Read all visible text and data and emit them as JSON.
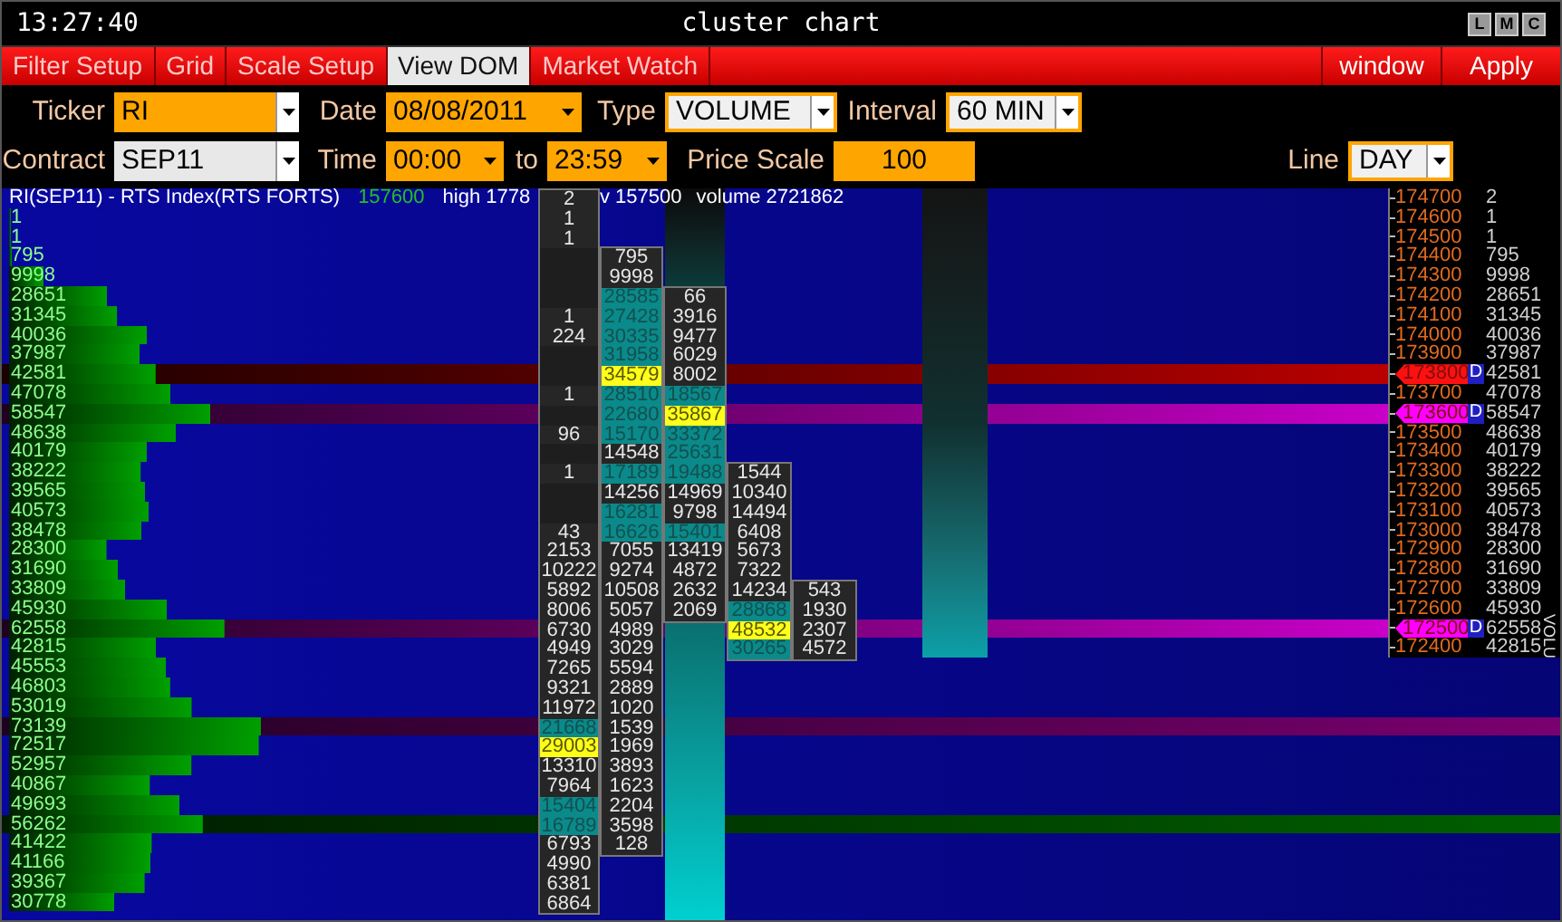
{
  "window": {
    "clock": "13:27:40",
    "title": "cluster chart",
    "buttons": [
      "L",
      "M",
      "C"
    ]
  },
  "menu": {
    "tabs": [
      {
        "label": "Filter Setup",
        "selected": false
      },
      {
        "label": "Grid",
        "selected": false
      },
      {
        "label": "Scale Setup",
        "selected": false
      },
      {
        "label": "View DOM",
        "selected": true
      },
      {
        "label": "Market Watch",
        "selected": false
      }
    ],
    "actions": [
      "window",
      "Apply"
    ]
  },
  "form": {
    "rows": [
      [
        {
          "label": "Ticker",
          "value": "RI",
          "kind": "orange-box"
        },
        {
          "label": "Date",
          "value": "08/08/2011",
          "kind": "orange-inline"
        },
        {
          "label": "Type",
          "value": "VOLUME",
          "kind": "outlined-box"
        },
        {
          "label": "Interval",
          "value": "60 MIN",
          "kind": "outlined-box"
        }
      ],
      [
        {
          "label": "Contract",
          "value": "SEP11",
          "kind": "light-box"
        },
        {
          "label": "Time",
          "value": "00:00",
          "kind": "orange-inline"
        },
        {
          "label": "to",
          "value": "23:59",
          "kind": "orange-inline"
        },
        {
          "label": "Price Scale",
          "value": "100",
          "kind": "orange-plain"
        },
        {
          "label": "Line",
          "value": "DAY",
          "kind": "outlined-box"
        }
      ]
    ]
  },
  "chart": {
    "header": {
      "symbol": "RI(SEP11) - RTS Index(RTS FORTS)",
      "last": "157600",
      "high": "high 1778",
      "low": "v 157500",
      "volume": "volume 2721862"
    },
    "profile": [
      {
        "value": "1"
      },
      {
        "value": "1"
      },
      {
        "value": "795"
      },
      {
        "value": "9998"
      },
      {
        "value": "28651"
      },
      {
        "value": "31345"
      },
      {
        "value": "40036"
      },
      {
        "value": "37987"
      },
      {
        "value": "42581",
        "kind": "red"
      },
      {
        "value": "47078"
      },
      {
        "value": "58547",
        "kind": "magenta"
      },
      {
        "value": "48638"
      },
      {
        "value": "40179"
      },
      {
        "value": "38222"
      },
      {
        "value": "39565"
      },
      {
        "value": "40573"
      },
      {
        "value": "38478"
      },
      {
        "value": "28300"
      },
      {
        "value": "31690"
      },
      {
        "value": "33809"
      },
      {
        "value": "45930"
      },
      {
        "value": "62558",
        "kind": "magenta"
      },
      {
        "value": "42815"
      },
      {
        "value": "45553"
      },
      {
        "value": "46803"
      },
      {
        "value": "53019"
      },
      {
        "value": "73139",
        "kind": "purple"
      },
      {
        "value": "72517"
      },
      {
        "value": "52957"
      },
      {
        "value": "40867"
      },
      {
        "value": "49693"
      },
      {
        "value": "56262",
        "kind": "green"
      },
      {
        "value": "41422"
      },
      {
        "value": "41166"
      },
      {
        "value": "39367"
      },
      {
        "value": "30778"
      }
    ],
    "clusters": [
      {
        "kind": "plain",
        "cells": [
          {
            "text": "2",
            "kind": "plain"
          },
          {
            "text": "1",
            "kind": "plain"
          },
          {
            "text": "1",
            "kind": "plain"
          },
          null,
          null,
          null,
          {
            "text": "1",
            "kind": "plain"
          },
          {
            "text": "224",
            "kind": "plain"
          },
          null,
          null,
          {
            "text": "1",
            "kind": "plain"
          },
          null,
          {
            "text": "96",
            "kind": "plain"
          },
          null,
          {
            "text": "1",
            "kind": "plain"
          },
          null,
          null,
          {
            "text": "43",
            "kind": "plain"
          },
          {
            "text": "2153",
            "kind": "plain"
          },
          {
            "text": "10222",
            "kind": "plain"
          },
          {
            "text": "5892",
            "kind": "plain"
          },
          {
            "text": "8006",
            "kind": "plain"
          },
          {
            "text": "6730",
            "kind": "plain"
          },
          {
            "text": "4949",
            "kind": "plain"
          },
          {
            "text": "7265",
            "kind": "plain"
          },
          {
            "text": "9321",
            "kind": "plain"
          },
          {
            "text": "11972",
            "kind": "plain"
          },
          {
            "text": "21668",
            "kind": "teal"
          },
          {
            "text": "29003",
            "kind": "yellow"
          },
          {
            "text": "13310",
            "kind": "plain"
          },
          {
            "text": "7964",
            "kind": "plain"
          },
          {
            "text": "15404",
            "kind": "teal"
          },
          {
            "text": "16789",
            "kind": "teal"
          },
          {
            "text": "6793",
            "kind": "plain"
          },
          {
            "text": "4990",
            "kind": "plain"
          },
          {
            "text": "6381",
            "kind": "plain"
          },
          {
            "text": "6864",
            "kind": "plain"
          }
        ]
      },
      {
        "kind": "plain",
        "cells": [
          null,
          null,
          null,
          {
            "text": "795",
            "kind": "plain"
          },
          {
            "text": "9998",
            "kind": "plain"
          },
          {
            "text": "28585",
            "kind": "teal"
          },
          {
            "text": "27428",
            "kind": "teal"
          },
          {
            "text": "30335",
            "kind": "teal"
          },
          {
            "text": "31958",
            "kind": "teal"
          },
          {
            "text": "34579",
            "kind": "yellow"
          },
          {
            "text": "28510",
            "kind": "teal"
          },
          {
            "text": "22680",
            "kind": "teal"
          },
          {
            "text": "15170",
            "kind": "teal"
          },
          {
            "text": "14548",
            "kind": "plain"
          },
          {
            "text": "17189",
            "kind": "teal"
          },
          {
            "text": "14256",
            "kind": "plain"
          },
          {
            "text": "16281",
            "kind": "teal"
          },
          {
            "text": "16626",
            "kind": "teal"
          },
          {
            "text": "7055",
            "kind": "plain"
          },
          {
            "text": "9274",
            "kind": "plain"
          },
          {
            "text": "10508",
            "kind": "plain"
          },
          {
            "text": "5057",
            "kind": "plain"
          },
          {
            "text": "4989",
            "kind": "plain"
          },
          {
            "text": "3029",
            "kind": "plain"
          },
          {
            "text": "5594",
            "kind": "plain"
          },
          {
            "text": "2889",
            "kind": "plain"
          },
          {
            "text": "1020",
            "kind": "plain"
          },
          {
            "text": "1539",
            "kind": "plain"
          },
          {
            "text": "1969",
            "kind": "plain"
          },
          {
            "text": "3893",
            "kind": "plain"
          },
          {
            "text": "1623",
            "kind": "plain"
          },
          {
            "text": "2204",
            "kind": "plain"
          },
          {
            "text": "3598",
            "kind": "plain"
          },
          {
            "text": "128",
            "kind": "plain"
          }
        ]
      },
      {
        "kind": "candle",
        "cells": [
          null,
          null,
          null,
          null,
          null,
          {
            "text": "66",
            "kind": "plain"
          },
          {
            "text": "3916",
            "kind": "plain"
          },
          {
            "text": "9477",
            "kind": "plain"
          },
          {
            "text": "6029",
            "kind": "plain"
          },
          {
            "text": "8002",
            "kind": "plain"
          },
          {
            "text": "18567",
            "kind": "teal"
          },
          {
            "text": "35867",
            "kind": "yellow"
          },
          {
            "text": "33372",
            "kind": "teal"
          },
          {
            "text": "25631",
            "kind": "teal"
          },
          {
            "text": "19488",
            "kind": "teal"
          },
          {
            "text": "14969",
            "kind": "plain"
          },
          {
            "text": "9798",
            "kind": "plain"
          },
          {
            "text": "15401",
            "kind": "teal"
          },
          {
            "text": "13419",
            "kind": "plain"
          },
          {
            "text": "4872",
            "kind": "plain"
          },
          {
            "text": "2632",
            "kind": "plain"
          },
          {
            "text": "2069",
            "kind": "plain"
          }
        ]
      },
      {
        "kind": "plain",
        "cells": [
          null,
          null,
          null,
          null,
          null,
          null,
          null,
          null,
          null,
          null,
          null,
          null,
          null,
          null,
          {
            "text": "1544",
            "kind": "plain"
          },
          {
            "text": "10340",
            "kind": "plain"
          },
          {
            "text": "14494",
            "kind": "plain"
          },
          {
            "text": "6408",
            "kind": "plain"
          },
          {
            "text": "5673",
            "kind": "plain"
          },
          {
            "text": "7322",
            "kind": "plain"
          },
          {
            "text": "14234",
            "kind": "plain"
          },
          {
            "text": "28868",
            "kind": "teal"
          },
          {
            "text": "48532",
            "kind": "yellow"
          },
          {
            "text": "30265",
            "kind": "teal"
          }
        ]
      },
      {
        "kind": "plain",
        "cells": [
          null,
          null,
          null,
          null,
          null,
          null,
          null,
          null,
          null,
          null,
          null,
          null,
          null,
          null,
          null,
          null,
          null,
          null,
          null,
          null,
          {
            "text": "543",
            "kind": "plain"
          },
          {
            "text": "1930",
            "kind": "plain"
          },
          {
            "text": "2307",
            "kind": "plain"
          },
          {
            "text": "4572",
            "kind": "plain"
          }
        ]
      }
    ],
    "axis": {
      "label": "VOLU",
      "rows": [
        {
          "price": "174700",
          "volume": "2"
        },
        {
          "price": "174600",
          "volume": "1"
        },
        {
          "price": "174500",
          "volume": "1"
        },
        {
          "price": "174400",
          "volume": "795"
        },
        {
          "price": "174300",
          "volume": "9998"
        },
        {
          "price": "174200",
          "volume": "28651"
        },
        {
          "price": "174100",
          "volume": "31345"
        },
        {
          "price": "174000",
          "volume": "40036"
        },
        {
          "price": "173900",
          "volume": "37987"
        },
        {
          "price": "173800",
          "volume": "42581",
          "kind": "red",
          "marker_label": "D"
        },
        {
          "price": "173700",
          "volume": "47078"
        },
        {
          "price": "173600",
          "volume": "58547",
          "kind": "magenta",
          "marker_label": "D"
        },
        {
          "price": "173500",
          "volume": "48638"
        },
        {
          "price": "173400",
          "volume": "40179"
        },
        {
          "price": "173300",
          "volume": "38222"
        },
        {
          "price": "173200",
          "volume": "39565"
        },
        {
          "price": "173100",
          "volume": "40573"
        },
        {
          "price": "173000",
          "volume": "38478"
        },
        {
          "price": "172900",
          "volume": "28300"
        },
        {
          "price": "172800",
          "volume": "31690"
        },
        {
          "price": "172700",
          "volume": "33809"
        },
        {
          "price": "172600",
          "volume": "45930"
        },
        {
          "price": "172500",
          "volume": "62558",
          "kind": "magenta",
          "marker_label": "D"
        },
        {
          "price": "172400",
          "volume": "42815"
        }
      ]
    }
  }
}
